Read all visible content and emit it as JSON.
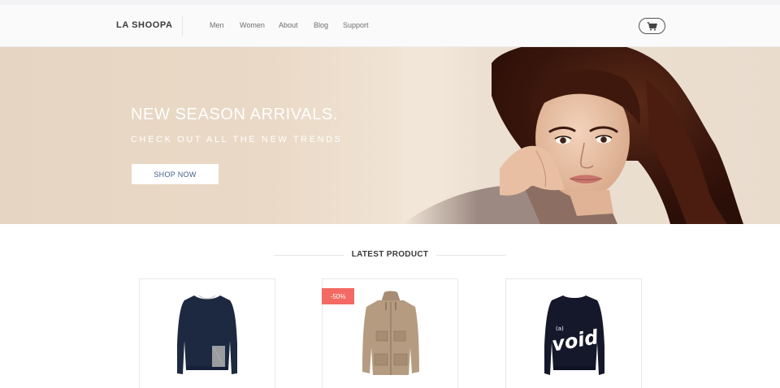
{
  "header": {
    "logo": "LA SHOOPA",
    "nav": [
      {
        "label": "Men"
      },
      {
        "label": "Women"
      },
      {
        "label": "About"
      },
      {
        "label": "Blog"
      },
      {
        "label": "Support"
      }
    ],
    "cart_icon": "cart-icon"
  },
  "hero": {
    "title": "NEW SEASON ARRIVALS.",
    "subtitle": "CHECK OUT ALL THE NEW TRENDS",
    "button": "SHOP NOW"
  },
  "latest": {
    "title": "LATEST PRODUCT",
    "products": [
      {
        "name": "navy-sweater",
        "badge": ""
      },
      {
        "name": "beige-parka",
        "badge": "-50%"
      },
      {
        "name": "void-sweatshirt",
        "badge": "",
        "print": "(a) void"
      }
    ]
  },
  "colors": {
    "badge": "#f26a63",
    "button_text": "#3f5f8a",
    "hero_bg": "#ead9c6"
  }
}
